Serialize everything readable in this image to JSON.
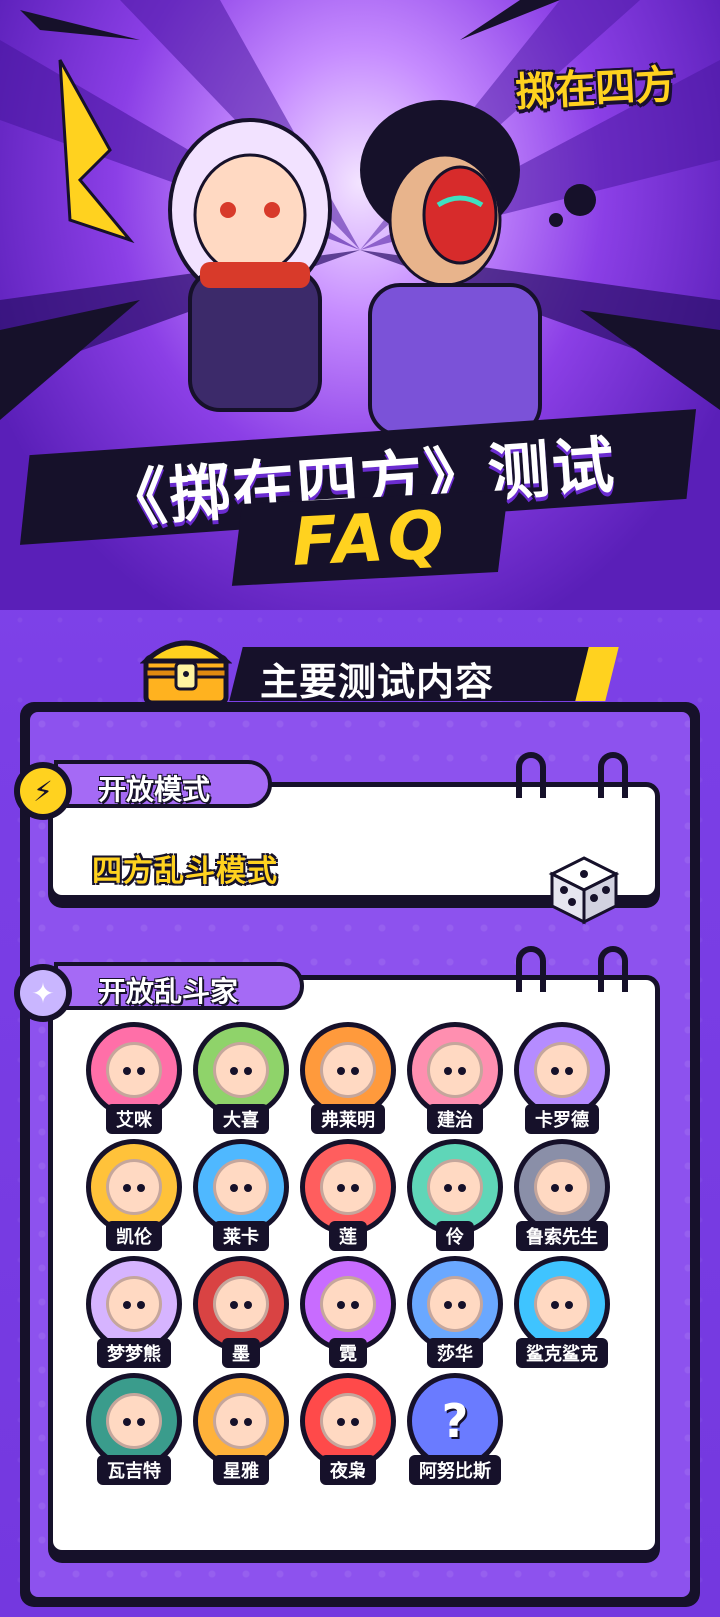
{
  "logo": {
    "text": "掷在四方"
  },
  "hero": {
    "title": "《掷在四方》测试",
    "subtitle": "FAQ"
  },
  "section": {
    "title": "主要测试内容",
    "chest_icon": "treasure-chest-icon"
  },
  "open_modes": {
    "label": "开放模式",
    "icon": "lightning-icon",
    "mode": "四方乱斗模式",
    "dice_icon": "dice-icon"
  },
  "fighters": {
    "label": "开放乱斗家",
    "icon": "sparkle-icon",
    "list": [
      {
        "name": "艾咪",
        "color": "#ff6fa8"
      },
      {
        "name": "大喜",
        "color": "#8fd36a"
      },
      {
        "name": "弗莱明",
        "color": "#ff9a3c"
      },
      {
        "name": "建治",
        "color": "#ff8fb0"
      },
      {
        "name": "卡罗德",
        "color": "#b58cff"
      },
      {
        "name": "凯伦",
        "color": "#ffc23a"
      },
      {
        "name": "莱卡",
        "color": "#4fb8ff"
      },
      {
        "name": "莲",
        "color": "#ff5e5e"
      },
      {
        "name": "伶",
        "color": "#5fd6b8"
      },
      {
        "name": "鲁索先生",
        "color": "#8a8fa8"
      },
      {
        "name": "梦梦熊",
        "color": "#d6b4ff"
      },
      {
        "name": "墨",
        "color": "#d94343"
      },
      {
        "name": "霓",
        "color": "#c86cff"
      },
      {
        "name": "莎华",
        "color": "#6aa8ff"
      },
      {
        "name": "鲨克鲨克",
        "color": "#3fc4ff"
      },
      {
        "name": "瓦吉特",
        "color": "#3a9c8c"
      },
      {
        "name": "星雅",
        "color": "#ffb23a"
      },
      {
        "name": "夜枭",
        "color": "#ff4a4a"
      },
      {
        "name": "阿努比斯",
        "color": "#6a7bff",
        "unknown": true,
        "mark": "?"
      }
    ]
  },
  "colors": {
    "accent_yellow": "#ffd21f",
    "ink": "#16112a",
    "purple": "#8d52ee"
  }
}
